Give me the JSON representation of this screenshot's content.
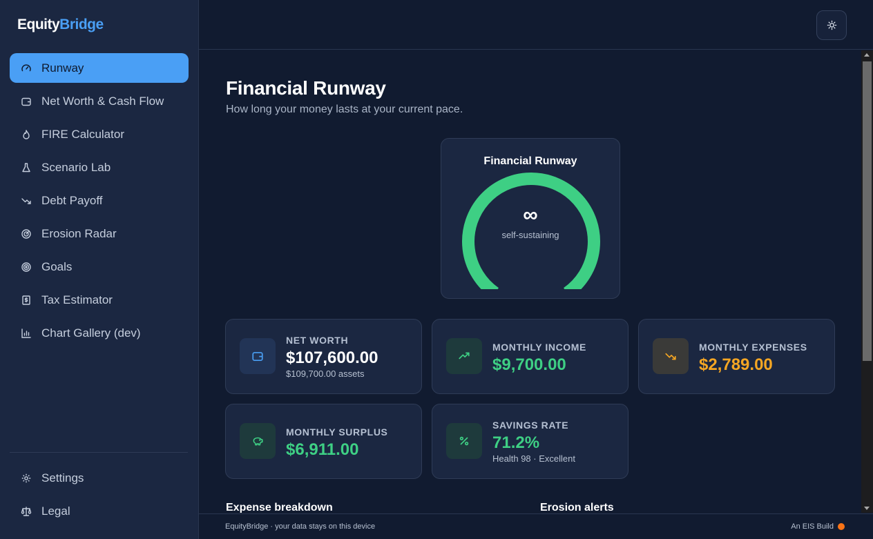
{
  "app": {
    "logo_part1": "Equity",
    "logo_part2": "Bridge"
  },
  "sidebar": {
    "items": [
      {
        "label": "Runway",
        "icon": "gauge-icon",
        "active": true
      },
      {
        "label": "Net Worth & Cash Flow",
        "icon": "wallet-icon"
      },
      {
        "label": "FIRE Calculator",
        "icon": "flame-icon"
      },
      {
        "label": "Scenario Lab",
        "icon": "flask-icon"
      },
      {
        "label": "Debt Payoff",
        "icon": "trending-down-icon"
      },
      {
        "label": "Erosion Radar",
        "icon": "radar-icon"
      },
      {
        "label": "Goals",
        "icon": "target-icon"
      },
      {
        "label": "Tax Estimator",
        "icon": "receipt-icon"
      },
      {
        "label": "Chart Gallery (dev)",
        "icon": "bar-chart-icon"
      }
    ],
    "bottom_items": [
      {
        "label": "Settings",
        "icon": "gear-icon"
      },
      {
        "label": "Legal",
        "icon": "scale-icon"
      }
    ]
  },
  "header": {
    "theme_toggle_icon": "sun-icon"
  },
  "page": {
    "title": "Financial Runway",
    "subtitle": "How long your money lasts at your current pace."
  },
  "gauge": {
    "title": "Financial Runway",
    "value": "∞",
    "caption": "self-sustaining",
    "fill_fraction": 1.0,
    "color": "#3ecf84"
  },
  "stats": {
    "net_worth": {
      "label": "NET WORTH",
      "value": "$107,600.00",
      "sub": "$109,700.00 assets",
      "icon": "wallet-icon"
    },
    "monthly_income": {
      "label": "MONTHLY INCOME",
      "value": "$9,700.00",
      "icon": "trending-up-icon"
    },
    "monthly_expenses": {
      "label": "MONTHLY EXPENSES",
      "value": "$2,789.00",
      "icon": "trending-down-icon"
    },
    "monthly_surplus": {
      "label": "MONTHLY SURPLUS",
      "value": "$6,911.00",
      "icon": "piggy-bank-icon"
    },
    "savings_rate": {
      "label": "SAVINGS RATE",
      "value": "71.2%",
      "sub": "Health 98 · Excellent",
      "icon": "percent-icon"
    }
  },
  "sections": {
    "expense_breakdown": "Expense breakdown",
    "erosion_alerts": "Erosion alerts"
  },
  "footer": {
    "left": "EquityBridge · your data stays on this device",
    "right": "An EIS Build"
  },
  "colors": {
    "accent": "#4a9ff5",
    "positive": "#3ecf84",
    "warning": "#f5a623",
    "footer_dot": "#f97316"
  }
}
